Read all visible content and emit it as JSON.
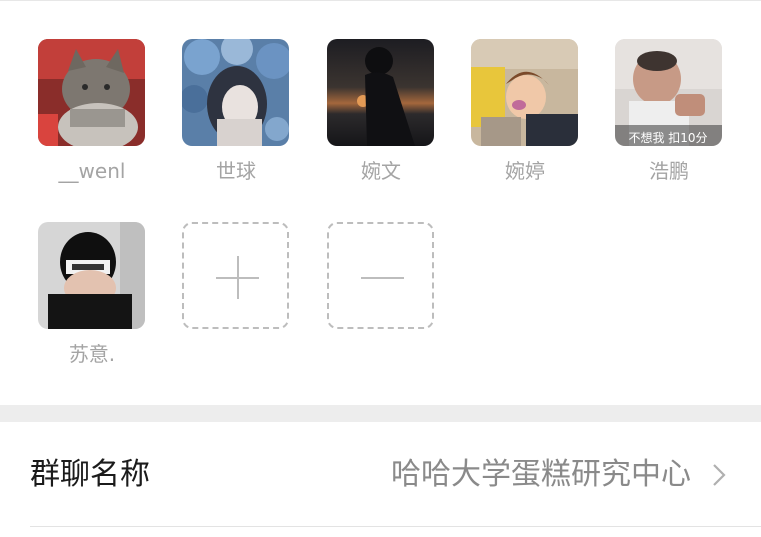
{
  "members": [
    {
      "name": "__wenl",
      "avatar_icon": "cat-avatar-icon"
    },
    {
      "name": "世球",
      "avatar_icon": "anime-girl-avatar-icon"
    },
    {
      "name": "婉文",
      "avatar_icon": "silhouette-sunset-avatar-icon"
    },
    {
      "name": "婉婷",
      "avatar_icon": "sleeping-child-avatar-icon"
    },
    {
      "name": "浩鹏",
      "avatar_icon": "baby-meme-avatar-icon",
      "avatar_caption": "不想我 扣10分"
    },
    {
      "name": "苏意.",
      "avatar_icon": "masked-girl-avatar-icon"
    }
  ],
  "actions": {
    "add_icon": "plus-icon",
    "remove_icon": "minus-icon"
  },
  "group_name": {
    "label": "群聊名称",
    "value": "哈哈大学蛋糕研究中心",
    "icon": "chevron-right-icon"
  },
  "colors": {
    "background": "#ffffff",
    "separator_band": "#ededed",
    "member_name": "#a4a4a4",
    "label_text": "#1b1b1b",
    "value_text": "#8a8a8a",
    "dashed_border": "#bdbdbd"
  }
}
